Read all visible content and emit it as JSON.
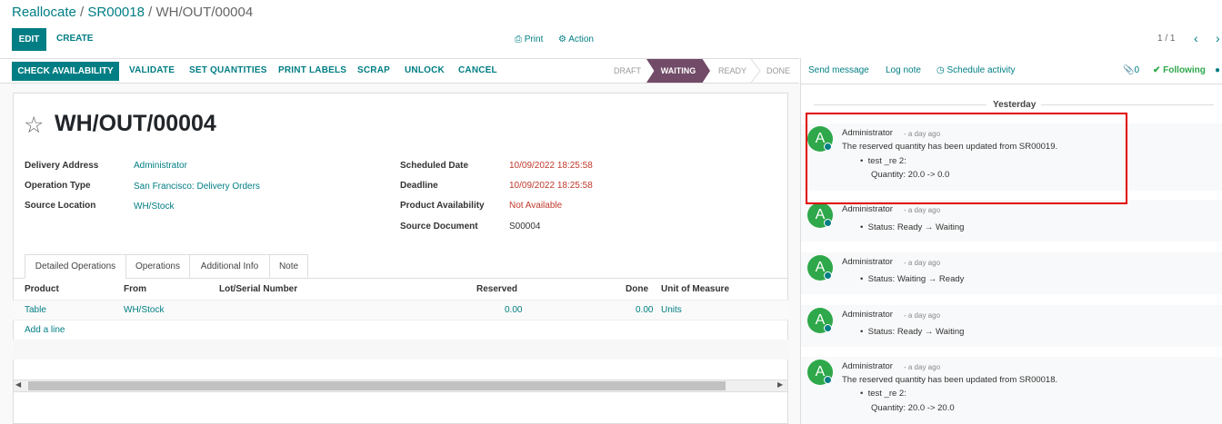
{
  "breadcrumb": {
    "item1": "Reallocate",
    "sep1": " / ",
    "item2": "SR00018",
    "sep2": " / ",
    "current": "WH/OUT/00004"
  },
  "control": {
    "edit": "EDIT",
    "create": "CREATE",
    "print": "Print",
    "action": "Action",
    "pager": "1 / 1"
  },
  "statusbar": {
    "buttons": [
      "CHECK AVAILABILITY",
      "VALIDATE",
      "SET QUANTITIES",
      "PRINT LABELS",
      "SCRAP",
      "UNLOCK",
      "CANCEL"
    ],
    "stages": [
      "DRAFT",
      "WAITING",
      "READY",
      "DONE"
    ],
    "active_stage": "WAITING"
  },
  "form": {
    "title": "WH/OUT/00004",
    "left": [
      {
        "label": "Delivery Address",
        "value": "Administrator"
      },
      {
        "label": "Operation Type",
        "value": "San Francisco: Delivery Orders"
      },
      {
        "label": "Source Location",
        "value": "WH/Stock"
      }
    ],
    "right": [
      {
        "label": "Scheduled Date",
        "value": "10/09/2022 18:25:58"
      },
      {
        "label": "Deadline",
        "value": "10/09/2022 18:25:58"
      },
      {
        "label": "Product Availability",
        "value": "Not Available"
      },
      {
        "label": "Source Document",
        "value": "S00004"
      }
    ],
    "tabs": [
      "Detailed Operations",
      "Operations",
      "Additional Info",
      "Note"
    ],
    "columns": [
      "Product",
      "From",
      "Lot/Serial Number",
      "Reserved",
      "Done",
      "Unit of Measure"
    ],
    "row": {
      "product": "Table",
      "from": "WH/Stock",
      "reserved": "0.00",
      "done": "0.00",
      "uom": "Units"
    },
    "add_line": "Add a line"
  },
  "chatter": {
    "send_message": "Send message",
    "log_note": "Log note",
    "schedule_activity": "Schedule activity",
    "attachments": "0",
    "following": "Following",
    "date_separator": "Yesterday",
    "messages": [
      {
        "avatar": "A",
        "author": "Administrator",
        "ago": "- a day ago",
        "body": "The reserved quantity has been updated from SR00019.",
        "bullet": "test _re 2:",
        "sub": "Quantity: 20.0 -> 0.0"
      },
      {
        "avatar": "A",
        "author": "Administrator",
        "ago": "- a day ago",
        "bullet": "Status: Ready → Waiting"
      },
      {
        "avatar": "A",
        "author": "Administrator",
        "ago": "- a day ago",
        "bullet": "Status: Waiting → Ready"
      },
      {
        "avatar": "A",
        "author": "Administrator",
        "ago": "- a day ago",
        "bullet": "Status: Ready → Waiting"
      },
      {
        "avatar": "A",
        "author": "Administrator",
        "ago": "- a day ago",
        "body": "The reserved quantity has been updated from SR00018.",
        "bullet": "test _re 2:",
        "sub": "Quantity: 20.0 -> 20.0"
      }
    ]
  },
  "colors": {
    "brand": "#017e84",
    "stage_active": "#714b67",
    "highlight": "#e00000",
    "avatar": "#2ea84a",
    "date_red": "#c0392b"
  }
}
